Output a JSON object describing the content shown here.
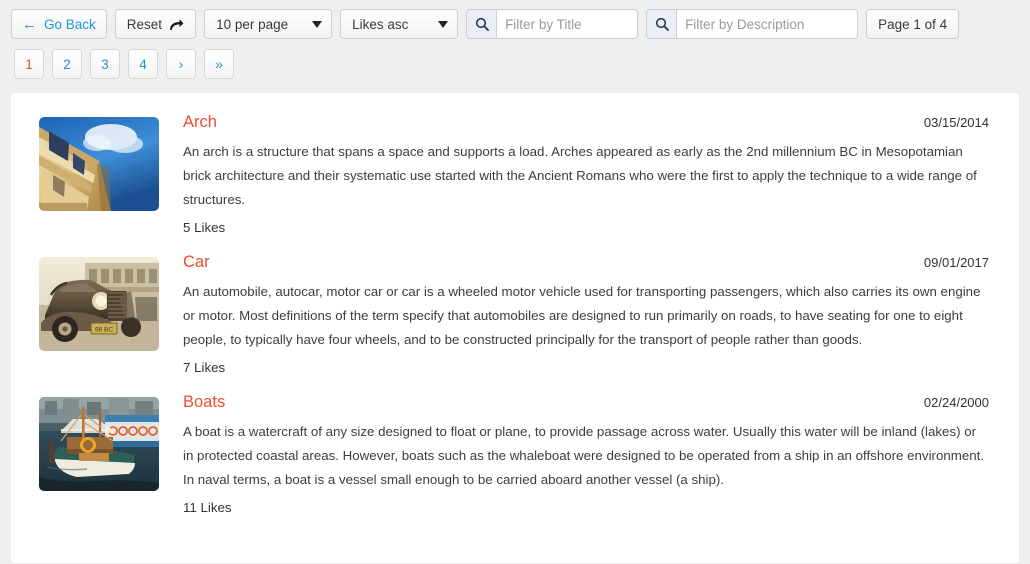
{
  "toolbar": {
    "go_back_label": "Go Back",
    "go_back_icon": "arrow-left-icon",
    "reset_label": "Reset",
    "reset_icon": "redo-arrow-icon",
    "per_page_value": "10 per page",
    "sort_value": "Likes asc",
    "search_icon": "search-icon",
    "filter_title_value": "",
    "filter_title_placeholder": "Filter by Title",
    "filter_desc_value": "",
    "filter_desc_placeholder": "Filter by Description",
    "page_indicator": "Page 1 of 4"
  },
  "pagination": {
    "pages": [
      "1",
      "2",
      "3",
      "4"
    ],
    "active_page": "1",
    "next_label": "›",
    "last_label": "»",
    "active_color": "#e8502a",
    "link_color": "#2b8fd0"
  },
  "items": [
    {
      "title": "Arch",
      "date": "03/15/2014",
      "description": "An arch is a structure that spans a space and supports a load. Arches appeared as early as the 2nd millennium BC in Mesopotamian brick architecture and their systematic use started with the Ancient Romans who were the first to apply the technique to a wide range of structures.",
      "likes": "5 Likes",
      "image_alt": "ornate-building-facade-against-blue-sky"
    },
    {
      "title": "Car",
      "date": "09/01/2017",
      "description": "An automobile, autocar, motor car or car is a wheeled motor vehicle used for transporting passengers, which also carries its own engine or motor. Most definitions of the term specify that automobiles are designed to run primarily on roads, to have seating for one to eight people, to typically have four wheels, and to be constructed principally for the transport of people rather than goods.",
      "likes": "7 Likes",
      "image_alt": "vintage-classic-car-sepia-street"
    },
    {
      "title": "Boats",
      "date": "02/24/2000",
      "description": "A boat is a watercraft of any size designed to float or plane, to provide passage across water. Usually this water will be inland (lakes) or in protected coastal areas. However, boats such as the whaleboat were designed to be operated from a ship in an offshore environment. In naval terms, a boat is a vessel small enough to be carried aboard another vessel (a ship).",
      "likes": "11 Likes",
      "image_alt": "wooden-boats-docked-in-harbor"
    }
  ],
  "colors": {
    "page_background": "#efeff0",
    "card_background": "#ffffff",
    "title": "#e8502a",
    "link": "#2b8fd0",
    "text": "#3d3d3d"
  }
}
